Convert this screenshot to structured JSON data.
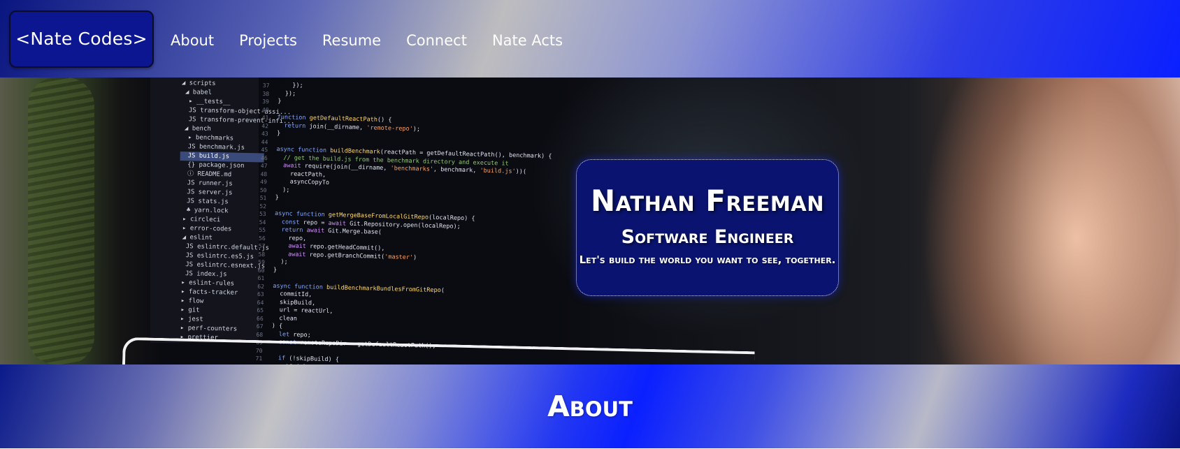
{
  "header": {
    "brand": "<Nate Codes>",
    "nav": [
      {
        "label": "About"
      },
      {
        "label": "Projects"
      },
      {
        "label": "Resume"
      },
      {
        "label": "Connect"
      },
      {
        "label": "Nate Acts"
      }
    ]
  },
  "hero": {
    "name": "Nathan Freeman",
    "role": "Software Engineer",
    "tagline": "Let's build the world you want to see, together."
  },
  "about": {
    "heading": "About"
  },
  "colors": {
    "nav_gradient_start": "#0a1680",
    "nav_gradient_end": "#0a20ff",
    "card_background": "#0a1470",
    "text": "#ffffff"
  }
}
